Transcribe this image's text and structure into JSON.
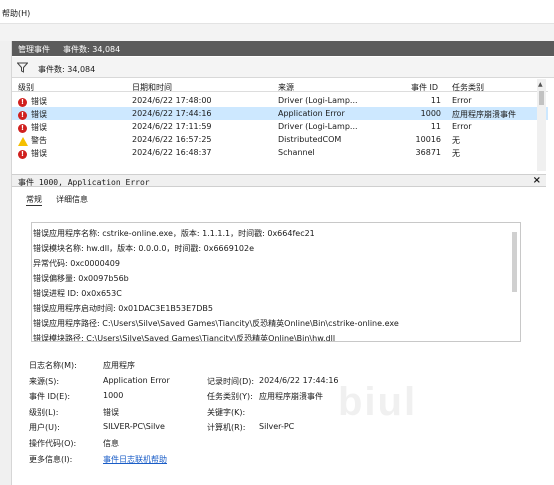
{
  "menu": {
    "help_label": "帮助(H)"
  },
  "header": {
    "title": "管理事件",
    "count": "事件数: 34,084"
  },
  "filter": {
    "label": "事件数: 34,084"
  },
  "table": {
    "columns": {
      "level": "级别",
      "date": "日期和时间",
      "source": "来源",
      "event_id": "事件 ID",
      "category": "任务类别"
    },
    "rows": [
      {
        "level": "错误",
        "icon": "error-icon",
        "date": "2024/6/22 17:48:00",
        "source": "Driver (Logi-Lamp...",
        "event_id": "11",
        "category": "Error"
      },
      {
        "level": "错误",
        "icon": "error-icon",
        "date": "2024/6/22 17:44:16",
        "source": "Application Error",
        "event_id": "1000",
        "category": "应用程序崩溃事件",
        "selected": true
      },
      {
        "level": "错误",
        "icon": "error-icon",
        "date": "2024/6/22 17:11:59",
        "source": "Driver (Logi-Lamp...",
        "event_id": "11",
        "category": "Error"
      },
      {
        "level": "警告",
        "icon": "warning-icon",
        "date": "2024/6/22 16:57:25",
        "source": "DistributedCOM",
        "event_id": "10016",
        "category": "无"
      },
      {
        "level": "错误",
        "icon": "error-icon",
        "date": "2024/6/22 16:48:37",
        "source": "Schannel",
        "event_id": "36871",
        "category": "无"
      }
    ]
  },
  "detail": {
    "title": "事件 1000, Application Error",
    "tabs": {
      "general": "常规",
      "details": "详细信息"
    },
    "message_lines": [
      "错误应用程序名称: cstrike-online.exe，版本: 1.1.1.1，时间戳: 0x664fec21",
      "错误模块名称: hw.dll，版本: 0.0.0.0，时间戳: 0x6669102e",
      "异常代码: 0xc0000409",
      "错误偏移量: 0x0097b56b",
      "错误进程 ID: 0x0x653C",
      "错误应用程序启动时间: 0x01DAC3E1B53E7DB5",
      "错误应用程序路径: C:\\Users\\Silve\\Saved Games\\Tiancity\\反恐精英Online\\Bin\\cstrike-online.exe",
      "错误模块路径: C:\\Users\\Silve\\Saved Games\\Tiancity\\反恐精英Online\\Bin\\hw.dll"
    ],
    "props": {
      "log_name_label": "日志名称(M):",
      "log_name": "应用程序",
      "source_label": "来源(S):",
      "source": "Application Error",
      "logged_label": "记录时间(D):",
      "logged": "2024/6/22 17:44:16",
      "event_id_label": "事件 ID(E):",
      "event_id": "1000",
      "task_label": "任务类别(Y):",
      "task": "应用程序崩溃事件",
      "level_label": "级别(L):",
      "level": "错误",
      "keywords_label": "关键字(K):",
      "keywords": "",
      "user_label": "用户(U):",
      "user": "SILVER-PC\\Silve",
      "computer_label": "计算机(R):",
      "computer": "Silver-PC",
      "opcode_label": "操作代码(O):",
      "opcode": "信息",
      "more_label": "更多信息(I):",
      "more_link": "事件日志联机帮助"
    }
  },
  "watermark": "biul"
}
